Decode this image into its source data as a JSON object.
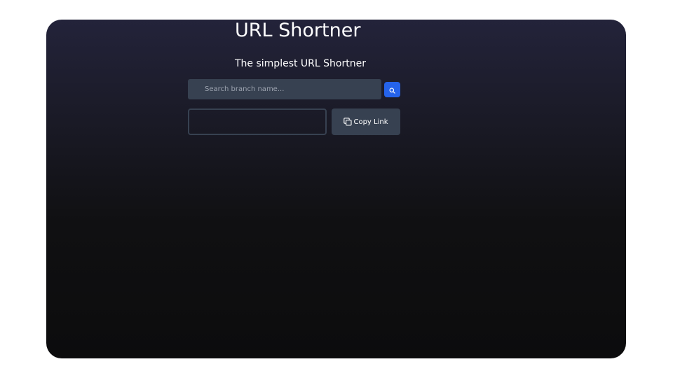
{
  "header": {
    "title": "URL Shortner",
    "subtitle": "The simplest URL Shortner"
  },
  "search": {
    "placeholder": "Search branch name...",
    "value": "",
    "button_icon": "search-icon"
  },
  "result": {
    "link_value": "",
    "copy_label": "Copy Link",
    "copy_icon": "copy-icon"
  },
  "colors": {
    "accent": "#2563eb",
    "input_bg": "#374151",
    "card_top": "#23233a",
    "card_bottom": "#0c0c0d"
  }
}
